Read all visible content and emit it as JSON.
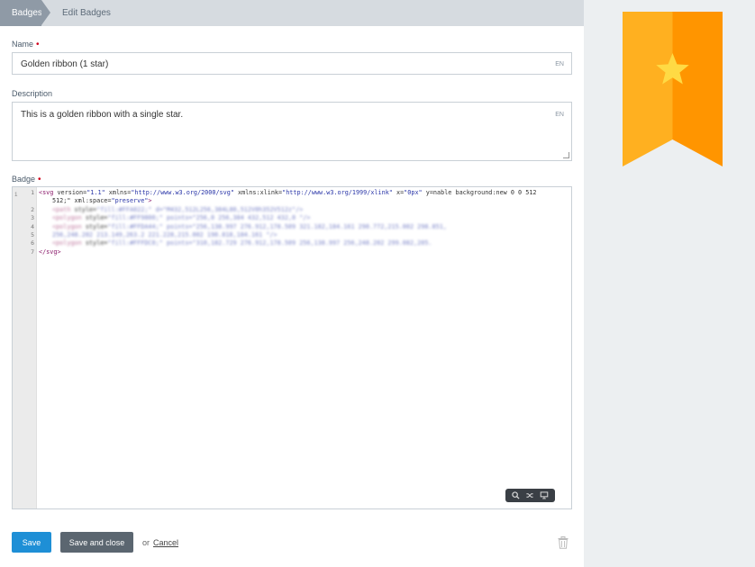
{
  "breadcrumb": {
    "items": [
      "Badges",
      "Edit Badges"
    ]
  },
  "form": {
    "name": {
      "label": "Name",
      "required_mark": "•",
      "value": "Golden ribbon (1 star)",
      "lang": "EN"
    },
    "description": {
      "label": "Description",
      "value": "This is a golden ribbon with a single star.",
      "lang": "EN"
    },
    "badge": {
      "label": "Badge",
      "required_mark": "•"
    }
  },
  "editor": {
    "line_numbers": [
      "1",
      "2",
      "3",
      "4",
      "5",
      "6",
      "7"
    ],
    "line1a": {
      "tag_open": "<svg",
      "a1": " version=",
      "v1": "\"1.1\"",
      "a2": " xmlns=",
      "v2": "\"http://www.w3.org/2000/svg\"",
      "a3": " xmlns:xlink=",
      "v3": "\"http://www.w3.org/1999/xlink\"",
      "a4": " x=",
      "v4": "\"0px\"",
      "a5": " y=",
      "a5b": "nable background:new 0 0 512"
    },
    "line1b": {
      "text": "512;\" xml:space=",
      "val": "\"preserve\"",
      "close": ">"
    },
    "blurred_lines": [
      {
        "tag": "<path",
        "attr": " style=",
        "val": "\"fill:#FFA022;\" d=\"M432,512L256,384L80,512V0h352V512z\"/>"
      },
      {
        "tag": "<polygon",
        "attr": " style=",
        "val": "\"fill:#FF9800;\" points=\"256,0 256,384 432,512 432,0 \"/>"
      },
      {
        "tag": "<polygon",
        "attr": " style=",
        "val": "\"fill:#FFDA44;\" points=\"256,138.997 276.912,178.509 321.182,184.161 290.772,215.002 298.851,"
      },
      {
        "tag": "",
        "attr": "",
        "val": "256,248.202 213.149,263.2 221.228,215.002 190.818,184.161 \"/>"
      },
      {
        "tag": "<polygon",
        "attr": " style=",
        "val": "\"fill:#FFFDC0;\" points=\"310,182.729 276.912,178.509 256,138.997 256,248.202 299.082,205."
      }
    ],
    "last_line": "</svg>"
  },
  "actions": {
    "save": "Save",
    "save_close": "Save and close",
    "or": "or",
    "cancel": "Cancel"
  },
  "colors": {
    "ribbon_left": "#FFB020",
    "ribbon_right": "#FF9500",
    "star": "#FFDA44",
    "primary": "#1E8FD6"
  }
}
